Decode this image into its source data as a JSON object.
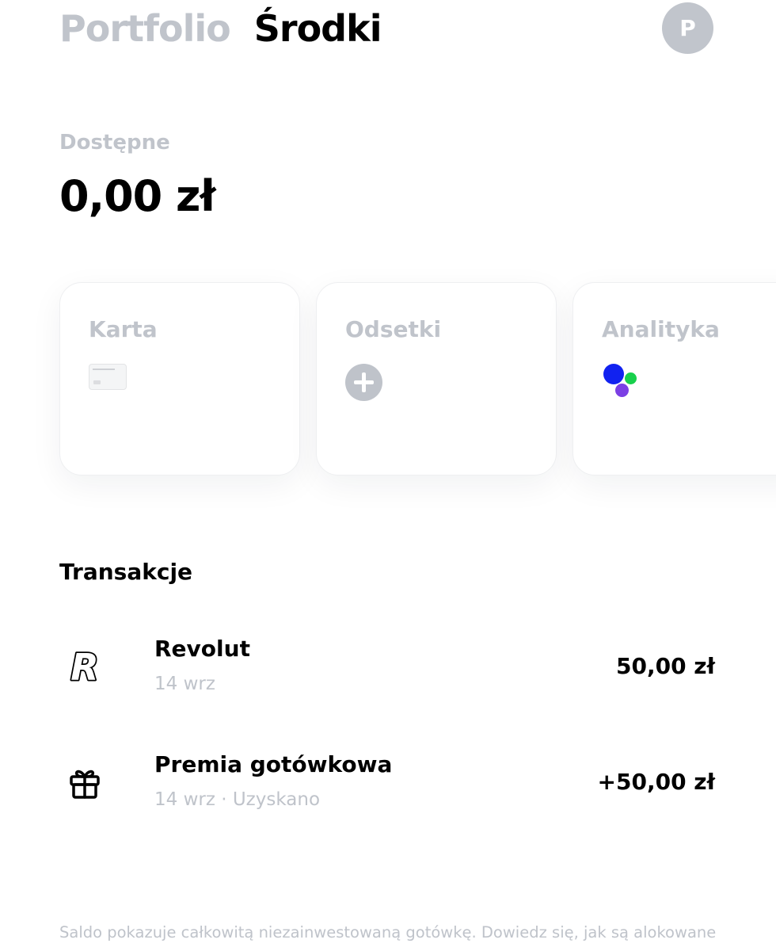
{
  "header": {
    "tabs": [
      {
        "label": "Portfolio",
        "active": false
      },
      {
        "label": "Środki",
        "active": true
      }
    ],
    "avatar_initial": "P"
  },
  "balance": {
    "label": "Dostępne",
    "value": "0,00 zł"
  },
  "cards": [
    {
      "title": "Karta",
      "icon": "credit-card-icon"
    },
    {
      "title": "Odsetki",
      "icon": "plus-circle-icon"
    },
    {
      "title": "Analityka",
      "icon": "colored-dots-icon"
    }
  ],
  "transactions": {
    "title": "Transakcje",
    "items": [
      {
        "name": "Revolut",
        "subtitle": "14 wrz",
        "amount": "50,00 zł",
        "icon": "revolut-logo-icon"
      },
      {
        "name": "Premia gotówkowa",
        "subtitle": "14 wrz · Uzyskano",
        "amount": "+50,00 zł",
        "icon": "gift-icon"
      }
    ]
  },
  "footer": {
    "note": "Saldo pokazuje całkowitą niezainwestowaną gotówkę. Dowiedz się, jak są alokowane"
  },
  "colors": {
    "muted_text": "#c0c4cb",
    "avatar_bg": "#c1c5cc",
    "dot_blue": "#1122f0",
    "dot_green": "#18d04c",
    "dot_purple": "#7b3fe4"
  }
}
